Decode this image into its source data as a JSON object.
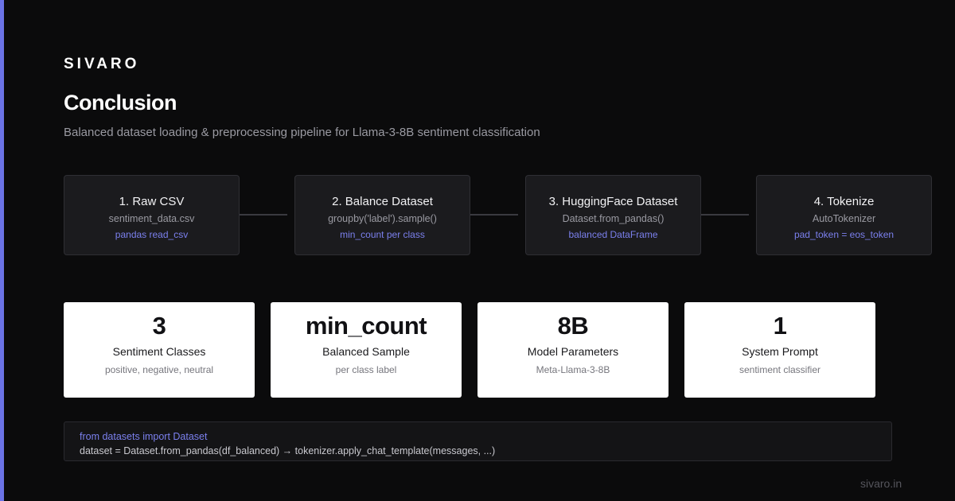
{
  "brand": "SIVARO",
  "title": "Conclusion",
  "subtitle": "Balanced dataset loading & preprocessing pipeline for Llama-3-8B sentiment classification",
  "colors": {
    "accent": "#6b73e6",
    "background": "#0b0b0c",
    "card": "#ffffff",
    "step_bg": "#1b1b1e",
    "note": "#7b80ee"
  },
  "pipeline": [
    {
      "title": "1. Raw CSV",
      "detail": "sentiment_data.csv",
      "note": "pandas read_csv"
    },
    {
      "title": "2. Balance Dataset",
      "detail": "groupby('label').sample()",
      "note": "min_count per class"
    },
    {
      "title": "3. HuggingFace Dataset",
      "detail": "Dataset.from_pandas()",
      "note": "balanced DataFrame"
    },
    {
      "title": "4. Tokenize",
      "detail": "AutoTokenizer",
      "note": "pad_token = eos_token"
    }
  ],
  "stats": [
    {
      "value": "3",
      "label": "Sentiment Classes",
      "sub": "positive, negative, neutral"
    },
    {
      "value": "min_count",
      "label": "Balanced Sample",
      "sub": "per class label"
    },
    {
      "value": "8B",
      "label": "Model Parameters",
      "sub": "Meta-Llama-3-8B"
    },
    {
      "value": "1",
      "label": "System Prompt",
      "sub": "sentiment classifier"
    }
  ],
  "code": {
    "line1": "from datasets import Dataset",
    "line2": "dataset = Dataset.from_pandas(df_balanced) → tokenizer.apply_chat_template(messages, ...)"
  },
  "footer": "sivaro.in"
}
